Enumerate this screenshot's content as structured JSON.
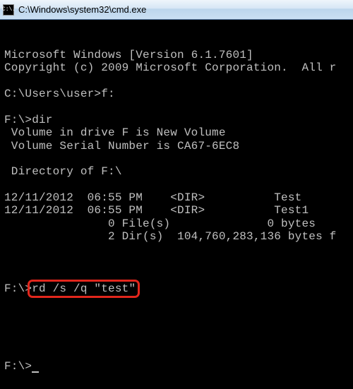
{
  "window": {
    "icon_glyph": "C:\\.",
    "title": "C:\\Windows\\system32\\cmd.exe"
  },
  "terminal": {
    "lines": [
      "Microsoft Windows [Version 6.1.7601]",
      "Copyright (c) 2009 Microsoft Corporation.  All r",
      "",
      "C:\\Users\\user>f:",
      "",
      "F:\\>dir",
      " Volume in drive F is New Volume",
      " Volume Serial Number is CA67-6EC8",
      "",
      " Directory of F:\\",
      "",
      "12/11/2012  06:55 PM    <DIR>          Test",
      "12/11/2012  06:55 PM    <DIR>          Test1",
      "               0 File(s)              0 bytes",
      "               2 Dir(s)  104,760,283,136 bytes f",
      ""
    ],
    "cmd_prompt": "F:\\>",
    "cmd_highlighted": "rd /s /q \"test\"",
    "final_prompt": "F:\\>"
  }
}
